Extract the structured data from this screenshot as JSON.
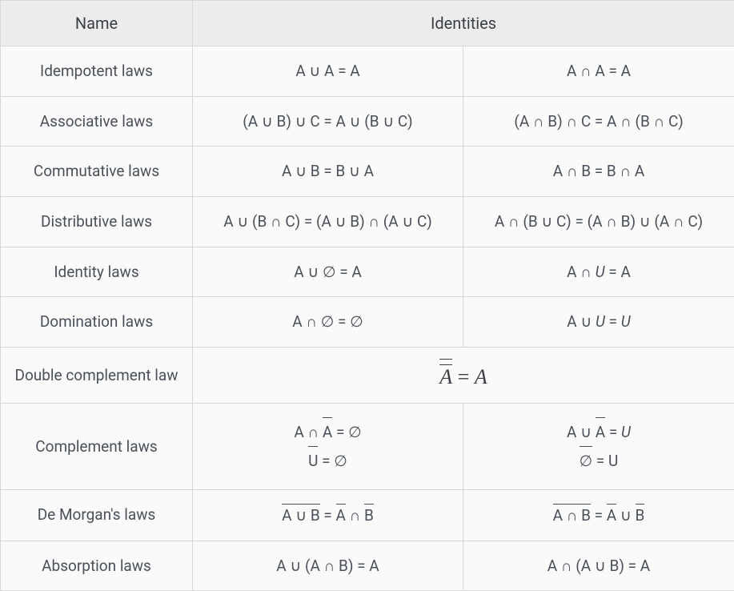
{
  "headers": {
    "name": "Name",
    "identities": "Identities"
  },
  "rows": {
    "idempotent": {
      "name": "Idempotent laws",
      "c1": "A ∪ A = A",
      "c2": "A ∩ A = A"
    },
    "associative": {
      "name": "Associative laws",
      "c1": "(A ∪ B) ∪ C = A ∪ (B ∪ C)",
      "c2": "(A ∩ B) ∩ C = A ∩ (B ∩ C)"
    },
    "commutative": {
      "name": "Commutative laws",
      "c1": "A ∪ B = B ∪ A",
      "c2": "A ∩ B = B ∩ A"
    },
    "distributive": {
      "name": "Distributive laws",
      "c1": "A ∪ (B ∩ C) = (A ∪ B) ∩ (A ∪ C)",
      "c2": "A ∩ (B ∪ C) = (A ∩ B) ∪ (A ∩ C)"
    },
    "identity": {
      "name": "Identity laws",
      "c1_pre": "A ∪ ∅ = A",
      "c2_pre": "A ∩ ",
      "c2_u": "U",
      "c2_post": " = A"
    },
    "domination": {
      "name": "Domination laws",
      "c1": "A ∩ ∅ = ∅",
      "c2_pre": "A ∪ ",
      "c2_u1": "U",
      "c2_mid": " = ",
      "c2_u2": "U"
    },
    "double_complement": {
      "name": "Double complement law",
      "expr_a": "A",
      "expr_eq": " = ",
      "expr_a2": "A"
    },
    "complement": {
      "name": "Complement laws",
      "c1_l1_pre": "A ∩ ",
      "c1_l1_bar": "A",
      "c1_l1_post": " = ∅",
      "c1_l2_bar": "U",
      "c1_l2_post": " = ∅",
      "c2_l1_pre": "A ∪ ",
      "c2_l1_bar": "A",
      "c2_l1_mid": " = ",
      "c2_l1_u": "U",
      "c2_l2_bar": "∅",
      "c2_l2_post": " = U"
    },
    "demorgan": {
      "name": "De Morgan's laws",
      "c1_bar1": "A ∪ B",
      "c1_mid": " = ",
      "c1_bar2": "A",
      "c1_op": " ∩ ",
      "c1_bar3": "B",
      "c2_bar1": "A ∩ B",
      "c2_mid": " = ",
      "c2_bar2": "A",
      "c2_op": " ∪ ",
      "c2_bar3": "B"
    },
    "absorption": {
      "name": "Absorption laws",
      "c1": "A ∪ (A ∩ B) = A",
      "c2": "A ∩ (A ∪ B) = A"
    }
  }
}
